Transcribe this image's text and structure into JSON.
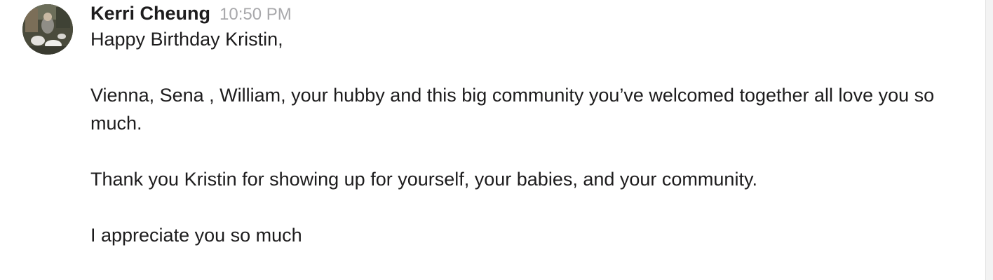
{
  "message": {
    "author": "Kerri Cheung",
    "time": "10:50 PM",
    "avatar_icon": "profile-photo",
    "paragraphs": [
      "Happy Birthday Kristin,",
      "Vienna, Sena , William, your hubby and this big community you’ve welcomed together all love you so much.",
      "Thank you Kristin for showing up for yourself, your babies, and your community.",
      "I appreciate you so much"
    ]
  }
}
